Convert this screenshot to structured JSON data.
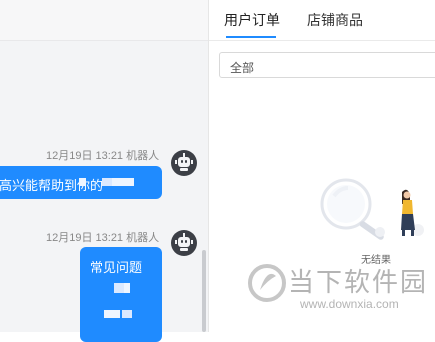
{
  "chat": {
    "messages": [
      {
        "meta": "12月19日 13:21  机器人",
        "text": "很高兴能帮助到你的"
      },
      {
        "meta": "12月19日 13:21  机器人",
        "text": "常见问题"
      }
    ]
  },
  "panel": {
    "tabs": [
      {
        "label": "用户订单",
        "active": true
      },
      {
        "label": "店铺商品",
        "active": false
      }
    ],
    "filter": {
      "value": "全部"
    },
    "empty": {
      "text": "无结果"
    }
  },
  "watermark": {
    "brand": "当下软件园",
    "url": "www.downxia.com"
  },
  "colors": {
    "accent": "#1f8bff",
    "avatar": "#3c3f46",
    "watermark_logo": "#c7c7c7"
  }
}
